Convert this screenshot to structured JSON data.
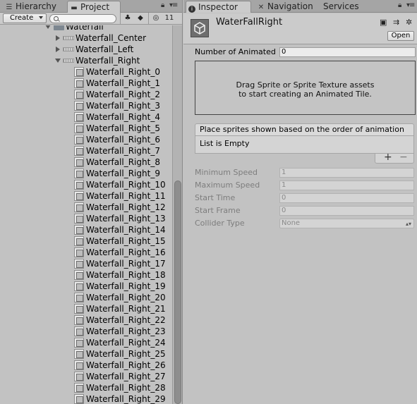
{
  "left_panel": {
    "tabs": [
      {
        "label": "Hierarchy",
        "icon": "hierarchy-list-icon"
      },
      {
        "label": "Project",
        "icon": "folder-icon"
      }
    ],
    "toolbar": {
      "create_label": "Create",
      "search_value": "",
      "hidden_count": "11"
    },
    "tree": {
      "root": "Waterfall",
      "folders": [
        "Waterfall_Center",
        "Waterfall_Left",
        "Waterfall_Right"
      ],
      "children": [
        "Waterfall_Right_0",
        "Waterfall_Right_1",
        "Waterfall_Right_2",
        "Waterfall_Right_3",
        "Waterfall_Right_4",
        "Waterfall_Right_5",
        "Waterfall_Right_6",
        "Waterfall_Right_7",
        "Waterfall_Right_8",
        "Waterfall_Right_9",
        "Waterfall_Right_10",
        "Waterfall_Right_11",
        "Waterfall_Right_12",
        "Waterfall_Right_13",
        "Waterfall_Right_14",
        "Waterfall_Right_15",
        "Waterfall_Right_16",
        "Waterfall_Right_17",
        "Waterfall_Right_18",
        "Waterfall_Right_19",
        "Waterfall_Right_20",
        "Waterfall_Right_21",
        "Waterfall_Right_22",
        "Waterfall_Right_23",
        "Waterfall_Right_24",
        "Waterfall_Right_25",
        "Waterfall_Right_26",
        "Waterfall_Right_27",
        "Waterfall_Right_28",
        "Waterfall_Right_29"
      ]
    }
  },
  "right_panel": {
    "tabs": [
      {
        "label": "Inspector",
        "icon": "info-icon"
      },
      {
        "label": "Navigation",
        "icon": "navigation-icon"
      },
      {
        "label": "Services",
        "icon": ""
      }
    ],
    "asset_name": "WaterFallRight",
    "open_label": "Open",
    "num_animated": {
      "label": "Number of Animated",
      "value": "0"
    },
    "dropbox": {
      "line1": "Drag Sprite or Sprite Texture assets",
      "line2": "to start creating an Animated Tile."
    },
    "list": {
      "header": "Place sprites shown based on the order of animation",
      "empty_text": "List is Empty",
      "add_label": "+",
      "remove_label": "−"
    },
    "fields": [
      {
        "label": "Minimum Speed",
        "value": "1"
      },
      {
        "label": "Maximum Speed",
        "value": "1"
      },
      {
        "label": "Start Time",
        "value": "0"
      },
      {
        "label": "Start Frame",
        "value": "0"
      }
    ],
    "collider": {
      "label": "Collider Type",
      "value": "None"
    }
  },
  "colors": {
    "panel_bg": "#c2c2c2",
    "tab_bar": "#a5a5a5",
    "folder_icon": "#7d8790"
  }
}
